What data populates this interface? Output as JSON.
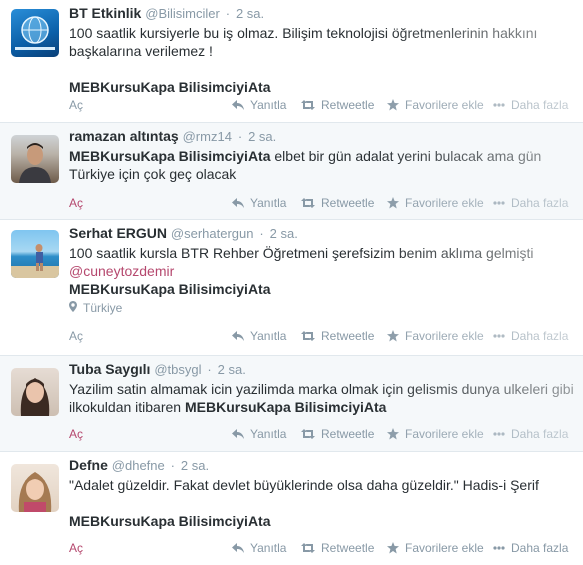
{
  "tweets": [
    {
      "name": "BT Etkinlik",
      "handle": "@Bilisimciler",
      "time": "2 sa.",
      "text_line1": "100 saatlik kursiyerle bu iş olmaz. Bilişim teknolojisi öğretmenlerinin hakkını",
      "text_line2": "başkalarına verilemez !",
      "hashtag": "MEBKursuKapa BilisimciyiAta",
      "expand": "Aç",
      "reply": "Yanıtla",
      "retweet": "Retweetle",
      "favorite": "Favorilere ekle",
      "more": "Daha fazla"
    },
    {
      "name": "ramazan altıntaş",
      "handle": "@rmz14",
      "time": "2 sa.",
      "hashtag": "MEBKursuKapa BilisimciyiAta",
      "text_rest": " elbet bir gün adalat yerini bulacak ama gün",
      "text_line2": "Türkiye için çok geç olacak",
      "expand": "Aç",
      "reply": "Yanıtla",
      "retweet": "Retweetle",
      "favorite": "Favorilere ekle",
      "more": "Daha fazla"
    },
    {
      "name": "Serhat ERGUN",
      "handle": "@serhatergun",
      "time": "2 sa.",
      "text_line1": "100 saatlik kursla BTR Rehber Öğretmeni şerefsizim benim aklıma gelmişti",
      "mention": "@cuneytozdemir",
      "hashtag": "MEBKursuKapa BilisimciyiAta",
      "location": "Türkiye",
      "expand": "Aç",
      "reply": "Yanıtla",
      "retweet": "Retweetle",
      "favorite": "Favorilere ekle",
      "more": "Daha fazla"
    },
    {
      "name": "Tuba Saygılı",
      "handle": "@tbsygl",
      "time": "2 sa.",
      "text_line1": "Yazilim satin almamak icin yazilimda marka olmak için gelismis dunya ulkeleri gibi",
      "text_line2_pre": "ilkokuldan itibaren ",
      "hashtag": "MEBKursuKapa BilisimciyiAta",
      "expand": "Aç",
      "reply": "Yanıtla",
      "retweet": "Retweetle",
      "favorite": "Favorilere ekle",
      "more": "Daha fazla"
    },
    {
      "name": "Defne",
      "handle": "@dhefne",
      "time": "2 sa.",
      "text_line1": "\"Adalet güzeldir. Fakat devlet büyüklerinde olsa daha güzeldir.\" Hadis-i Şerif",
      "hashtag": "MEBKursuKapa BilisimciyiAta",
      "expand": "Aç",
      "reply": "Yanıtla",
      "retweet": "Retweetle",
      "favorite": "Favorilere ekle",
      "more": "Daha fazla"
    }
  ],
  "colors": {
    "link": "#b5486e",
    "muted": "#8899a6",
    "text": "#292f33"
  }
}
